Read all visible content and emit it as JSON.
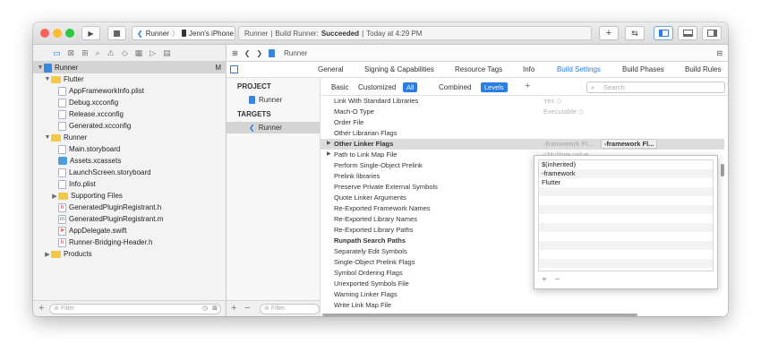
{
  "titlebar": {
    "scheme_target": "Runner",
    "scheme_device": "Jenn's iPhone",
    "status_project": "Runner",
    "status_action": "Build Runner:",
    "status_result": "Succeeded",
    "status_time": "Today at 4:29 PM"
  },
  "navigator": {
    "items": [
      {
        "label": "Runner",
        "badge": "M"
      },
      {
        "label": "Flutter"
      },
      {
        "label": "AppFrameworkInfo.plist"
      },
      {
        "label": "Debug.xcconfig"
      },
      {
        "label": "Release.xcconfig"
      },
      {
        "label": "Generated.xcconfig"
      },
      {
        "label": "Runner"
      },
      {
        "label": "Main.storyboard"
      },
      {
        "label": "Assets.xcassets"
      },
      {
        "label": "LaunchScreen.storyboard"
      },
      {
        "label": "Info.plist"
      },
      {
        "label": "Supporting Files"
      },
      {
        "label": "GeneratedPluginRegistrant.h"
      },
      {
        "label": "GeneratedPluginRegistrant.m"
      },
      {
        "label": "AppDelegate.swift"
      },
      {
        "label": "Runner-Bridging-Header.h"
      },
      {
        "label": "Products"
      }
    ],
    "filter_placeholder": "Filter"
  },
  "jumpbar": {
    "crumb": "Runner"
  },
  "tabs": [
    "General",
    "Signing & Capabilities",
    "Resource Tags",
    "Info",
    "Build Settings",
    "Build Phases",
    "Build Rules"
  ],
  "targets_panel": {
    "project_heading": "PROJECT",
    "project_item": "Runner",
    "targets_heading": "TARGETS",
    "target_item": "Runner",
    "filter_placeholder": "Filter"
  },
  "settings_bar": {
    "basic": "Basic",
    "customized": "Customized",
    "all": "All",
    "combined": "Combined",
    "levels": "Levels",
    "add": "+",
    "search_placeholder": "Search"
  },
  "settings_rows": [
    {
      "name": "Link With Standard Libraries",
      "value": "Yes ◇"
    },
    {
      "name": "Mach-O Type",
      "value": "Executable ◇"
    },
    {
      "name": "Order File",
      "value": ""
    },
    {
      "name": "Other Librarian Flags",
      "value": ""
    },
    {
      "name": "Other Linker Flags",
      "value": "-framework Fl...",
      "value2": "-framework Fl..."
    },
    {
      "name": "Path to Link Map File",
      "value": "<Multiple value..."
    },
    {
      "name": "Perform Single-Object Prelink",
      "value": ""
    },
    {
      "name": "Prelink libraries",
      "value": ""
    },
    {
      "name": "Preserve Private External Symbols",
      "value": ""
    },
    {
      "name": "Quote Linker Arguments",
      "value": ""
    },
    {
      "name": "Re-Exported Framework Names",
      "value": ""
    },
    {
      "name": "Re-Exported Library Names",
      "value": ""
    },
    {
      "name": "Re-Exported Library Paths",
      "value": ""
    },
    {
      "name": "Runpath Search Paths",
      "value": ""
    },
    {
      "name": "Separately Edit Symbols",
      "value": ""
    },
    {
      "name": "Single-Object Prelink Flags",
      "value": ""
    },
    {
      "name": "Symbol Ordering Flags",
      "value": ""
    },
    {
      "name": "Unexported Symbols File",
      "value": ""
    },
    {
      "name": "Warning Linker Flags",
      "value": ""
    },
    {
      "name": "Write Link Map File",
      "value": ""
    }
  ],
  "popover": {
    "values": [
      "$(inherited)",
      "-framework",
      "Flutter"
    ],
    "add": "+",
    "remove": "−"
  },
  "colors": {
    "accent": "#2a7de1",
    "close": "#fc5f57",
    "minimize": "#fdbc2e",
    "zoom": "#28c840"
  }
}
